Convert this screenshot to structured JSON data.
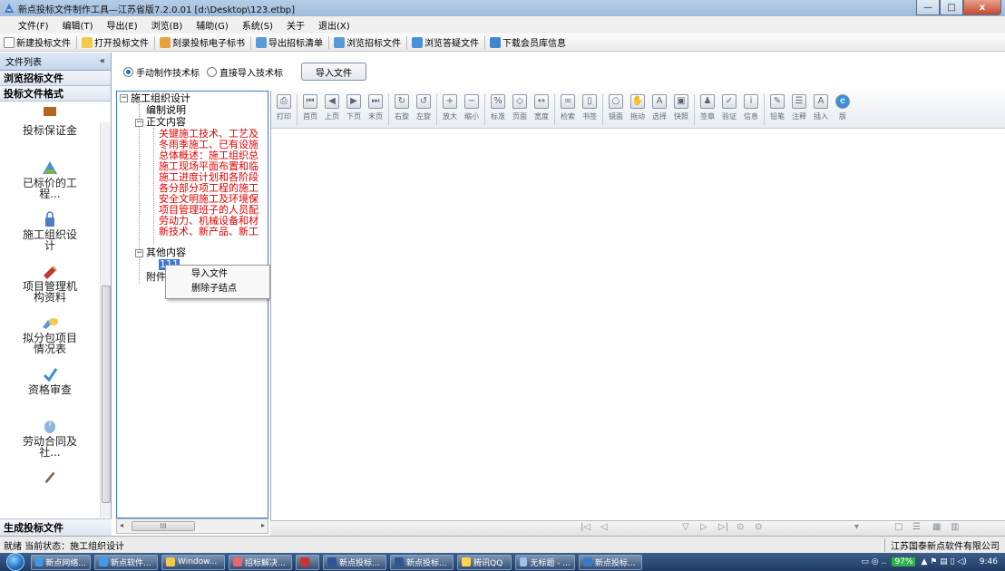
{
  "window": {
    "title": "新点投标文件制作工具—江苏省版7.2.0.01    [d:\\Desktop\\123.etbp]",
    "min": "—",
    "max": "□",
    "close": "x"
  },
  "menu": [
    "文件(F)",
    "编辑(T)",
    "导出(E)",
    "浏览(B)",
    "辅助(G)",
    "系统(S)",
    "关于",
    "退出(X)"
  ],
  "toolbar": [
    "新建投标文件",
    "打开投标文件",
    "刻录投标电子标书",
    "导出招标清单",
    "浏览招标文件",
    "浏览答疑文件",
    "下载会员库信息"
  ],
  "sidebar": {
    "header": "文件列表",
    "collapse": "«",
    "cat1": "浏览招标文件",
    "cat2": "投标文件格式",
    "items": [
      "投标保证金",
      "已标价的工程...",
      "施工组织设计",
      "项目管理机构资料",
      "拟分包项目情况表",
      "资格审查",
      "劳动合同及社..."
    ],
    "bottom": "生成投标文件"
  },
  "radio": {
    "opt1": "手动制作技术标",
    "opt2": "直接导入技术标",
    "import_btn": "导入文件"
  },
  "tree": {
    "root": "施工组织设计",
    "n1": "编制说明",
    "n2": "正文内容",
    "red_items": [
      "关键施工技术、工艺及",
      "冬雨季施工、已有设施",
      "总体概述：施工组织总",
      "施工现场平面布置和临",
      "施工进度计划和各阶段",
      "各分部分项工程的施工",
      "安全文明施工及环境保",
      "项目管理班子的人员配",
      "劳动力、机械设备和材",
      "新技术、新产品、新工"
    ],
    "n3": "其他内容",
    "selected": "111",
    "n4": "附件",
    "scroll_label": "III"
  },
  "context_menu": [
    "导入文件",
    "删除子结点"
  ],
  "viewer_tools": [
    "打印",
    "首页",
    "上页",
    "下页",
    "末页",
    "右旋",
    "左旋",
    "放大",
    "缩小",
    "标准",
    "页面",
    "宽度",
    "检索",
    "书签",
    "镜面",
    "拖动",
    "选择",
    "快照",
    "签章",
    "验证",
    "信息",
    "铅笔",
    "注释",
    "插入",
    "版"
  ],
  "viewer_bottom": [
    "|◁",
    "◁",
    "▽",
    "▷",
    "▷|",
    "⊙",
    "⊙",
    "▾",
    "□",
    "☰",
    "▦",
    "▥"
  ],
  "status": {
    "left": "就绪  当前状态：施工组织设计",
    "right": "江苏国泰新点软件有限公司"
  },
  "taskbar": {
    "tasks": [
      "新点网络...",
      "新点软件...",
      "Window...",
      "招标解决...",
      "",
      "新点投标...",
      "新点投标...",
      "腾讯QQ",
      "无标题 - ...",
      "新点投标..."
    ],
    "battery": "97%",
    "time": "9:46"
  },
  "colors": {
    "tree_red": "#e60000",
    "selection": "#3b78d8",
    "taskbar": "#1f3b63"
  }
}
